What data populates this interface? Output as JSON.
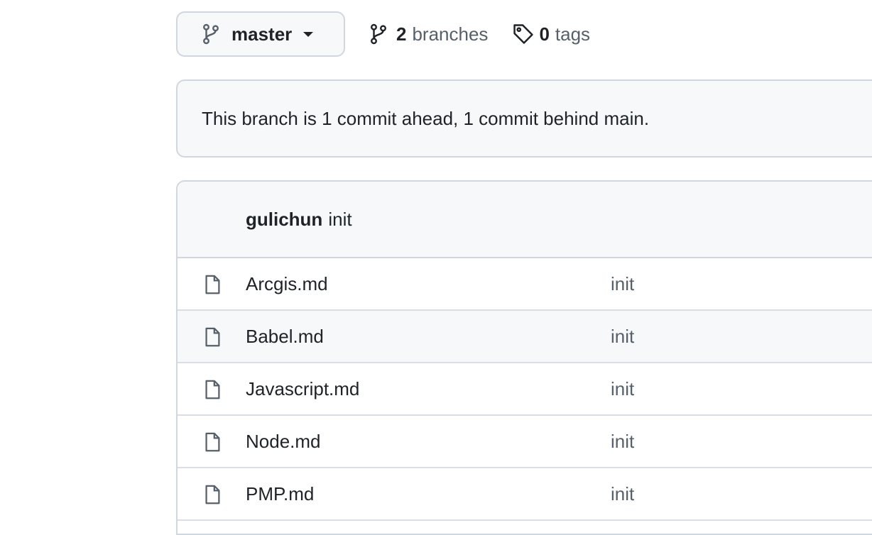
{
  "branch_selector": {
    "current_branch": "master"
  },
  "branches": {
    "count": "2",
    "label": "branches"
  },
  "tags": {
    "count": "0",
    "label": "tags"
  },
  "branch_status": {
    "text": "This branch is 1 commit ahead, 1 commit behind main."
  },
  "latest_commit": {
    "author": "gulichun",
    "message": "init"
  },
  "files": [
    {
      "name": "Arcgis.md",
      "commit_message": "init",
      "icon": "file-icon"
    },
    {
      "name": "Babel.md",
      "commit_message": "init",
      "icon": "file-icon"
    },
    {
      "name": "Javascript.md",
      "commit_message": "init",
      "icon": "file-icon"
    },
    {
      "name": "Node.md",
      "commit_message": "init",
      "icon": "file-icon"
    },
    {
      "name": "PMP.md",
      "commit_message": "init",
      "icon": "file-icon"
    }
  ],
  "colors": {
    "border": "#d0d7de",
    "muted_bg": "#f6f8fa",
    "text": "#1f2328",
    "muted_text": "#57606a"
  }
}
